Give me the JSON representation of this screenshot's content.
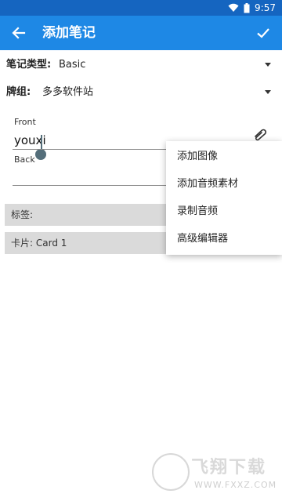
{
  "status_bar": {
    "time": "9:57"
  },
  "app_bar": {
    "title": "添加笔记",
    "back_icon": "arrow-left-icon",
    "confirm_icon": "check-icon"
  },
  "note_type": {
    "label": "笔记类型:",
    "value": "Basic"
  },
  "deck": {
    "label": "牌组:",
    "value": "多多软件站"
  },
  "fields": {
    "front": {
      "label": "Front",
      "value": "youxi"
    },
    "back": {
      "label": "Back",
      "value": ""
    }
  },
  "tags": {
    "label": "标签:"
  },
  "cards": {
    "label": "卡片: Card 1"
  },
  "menu": {
    "items": [
      {
        "label": "添加图像"
      },
      {
        "label": "添加音频素材"
      },
      {
        "label": "录制音频"
      },
      {
        "label": "高级编辑器"
      }
    ]
  },
  "watermark": {
    "title": "飞翔下载",
    "url": "WWW.FXXZ.COM"
  },
  "colors": {
    "status_bar": "#1565c0",
    "app_bar": "#1e88e5",
    "cursor": "#546e7a",
    "gray_bar": "#dadada"
  }
}
